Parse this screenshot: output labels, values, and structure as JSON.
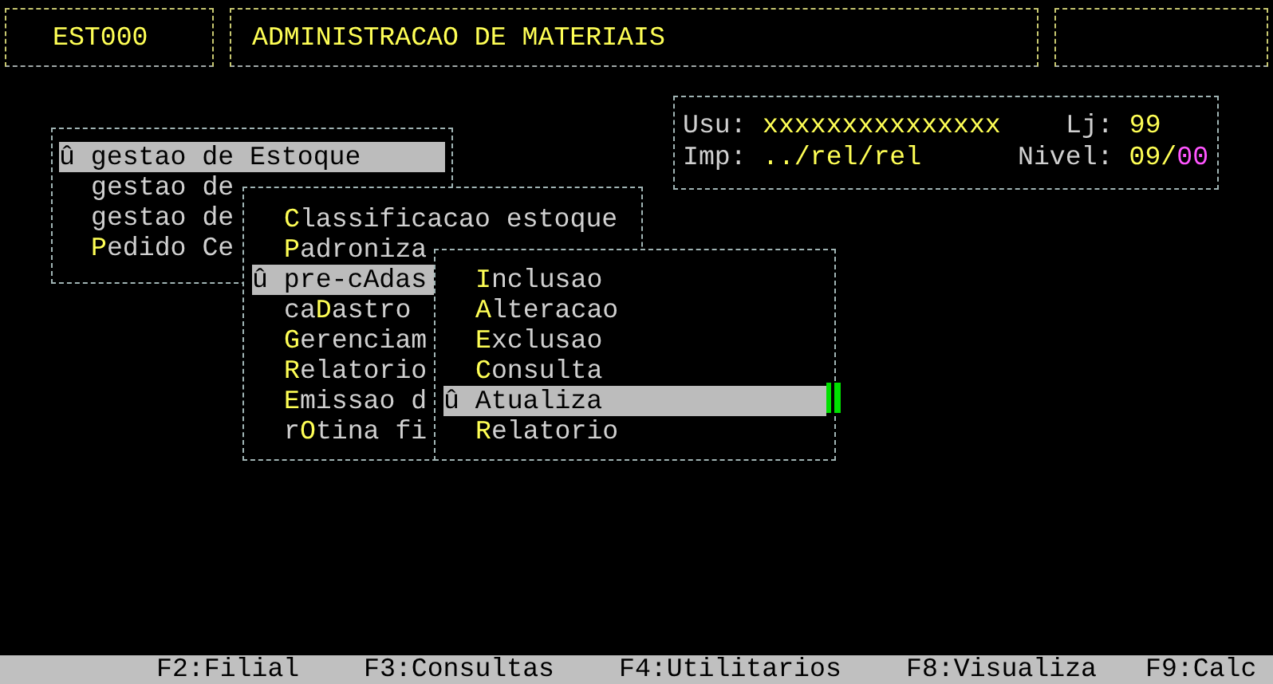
{
  "header": {
    "code": "EST000",
    "title": "ADMINISTRACAO DE MATERIAIS"
  },
  "info": {
    "user_label": "Usu:",
    "user": "xxxxxxxxxxxxxxx",
    "store_label": "Lj:",
    "store": "99",
    "printer_label": "Imp:",
    "printer": "../rel/rel",
    "level_label": "Nivel:",
    "level_a": "09/",
    "level_b": "00"
  },
  "menus": [
    {
      "items": [
        {
          "selected": true,
          "parts": [
            {
              "text": "û gestao de Estoque",
              "hot": false
            }
          ]
        },
        {
          "selected": false,
          "parts": [
            {
              "text": "gestao de",
              "hot": false
            }
          ]
        },
        {
          "selected": false,
          "parts": [
            {
              "text": "gestao de",
              "hot": false
            }
          ]
        },
        {
          "selected": false,
          "parts": [
            {
              "text": "P",
              "hot": true
            },
            {
              "text": "edido Ce",
              "hot": false
            }
          ]
        }
      ]
    },
    {
      "items": [
        {
          "selected": false,
          "parts": [
            {
              "text": "C",
              "hot": true
            },
            {
              "text": "lassificacao estoque",
              "hot": false
            }
          ]
        },
        {
          "selected": false,
          "parts": [
            {
              "text": "P",
              "hot": true
            },
            {
              "text": "adroniza",
              "hot": false
            }
          ]
        },
        {
          "selected": true,
          "parts": [
            {
              "text": "û pre-cAdas",
              "hot": false
            }
          ]
        },
        {
          "selected": false,
          "parts": [
            {
              "text": "ca",
              "hot": false
            },
            {
              "text": "D",
              "hot": true
            },
            {
              "text": "astro",
              "hot": false
            }
          ]
        },
        {
          "selected": false,
          "parts": [
            {
              "text": "G",
              "hot": true
            },
            {
              "text": "erenciam",
              "hot": false
            }
          ]
        },
        {
          "selected": false,
          "parts": [
            {
              "text": "R",
              "hot": true
            },
            {
              "text": "elatorio",
              "hot": false
            }
          ]
        },
        {
          "selected": false,
          "parts": [
            {
              "text": "E",
              "hot": true
            },
            {
              "text": "missao d",
              "hot": false
            }
          ]
        },
        {
          "selected": false,
          "parts": [
            {
              "text": "r",
              "hot": false
            },
            {
              "text": "O",
              "hot": true
            },
            {
              "text": "tina fi",
              "hot": false
            }
          ]
        }
      ]
    },
    {
      "items": [
        {
          "selected": false,
          "parts": [
            {
              "text": "I",
              "hot": true
            },
            {
              "text": "nclusao",
              "hot": false
            }
          ]
        },
        {
          "selected": false,
          "parts": [
            {
              "text": "A",
              "hot": true
            },
            {
              "text": "lteracao",
              "hot": false
            }
          ]
        },
        {
          "selected": false,
          "parts": [
            {
              "text": "E",
              "hot": true
            },
            {
              "text": "xclusao",
              "hot": false
            }
          ]
        },
        {
          "selected": false,
          "parts": [
            {
              "text": "C",
              "hot": true
            },
            {
              "text": "onsulta",
              "hot": false
            }
          ]
        },
        {
          "selected": true,
          "parts": [
            {
              "text": "û Atualiza",
              "hot": false
            }
          ]
        },
        {
          "selected": false,
          "parts": [
            {
              "text": "R",
              "hot": true
            },
            {
              "text": "elatorio",
              "hot": false
            }
          ]
        }
      ]
    }
  ],
  "function_keys": [
    "F2:Filial",
    "F3:Consultas",
    "F4:Utilitarios",
    "F8:Visualiza",
    "F9:Calc"
  ]
}
